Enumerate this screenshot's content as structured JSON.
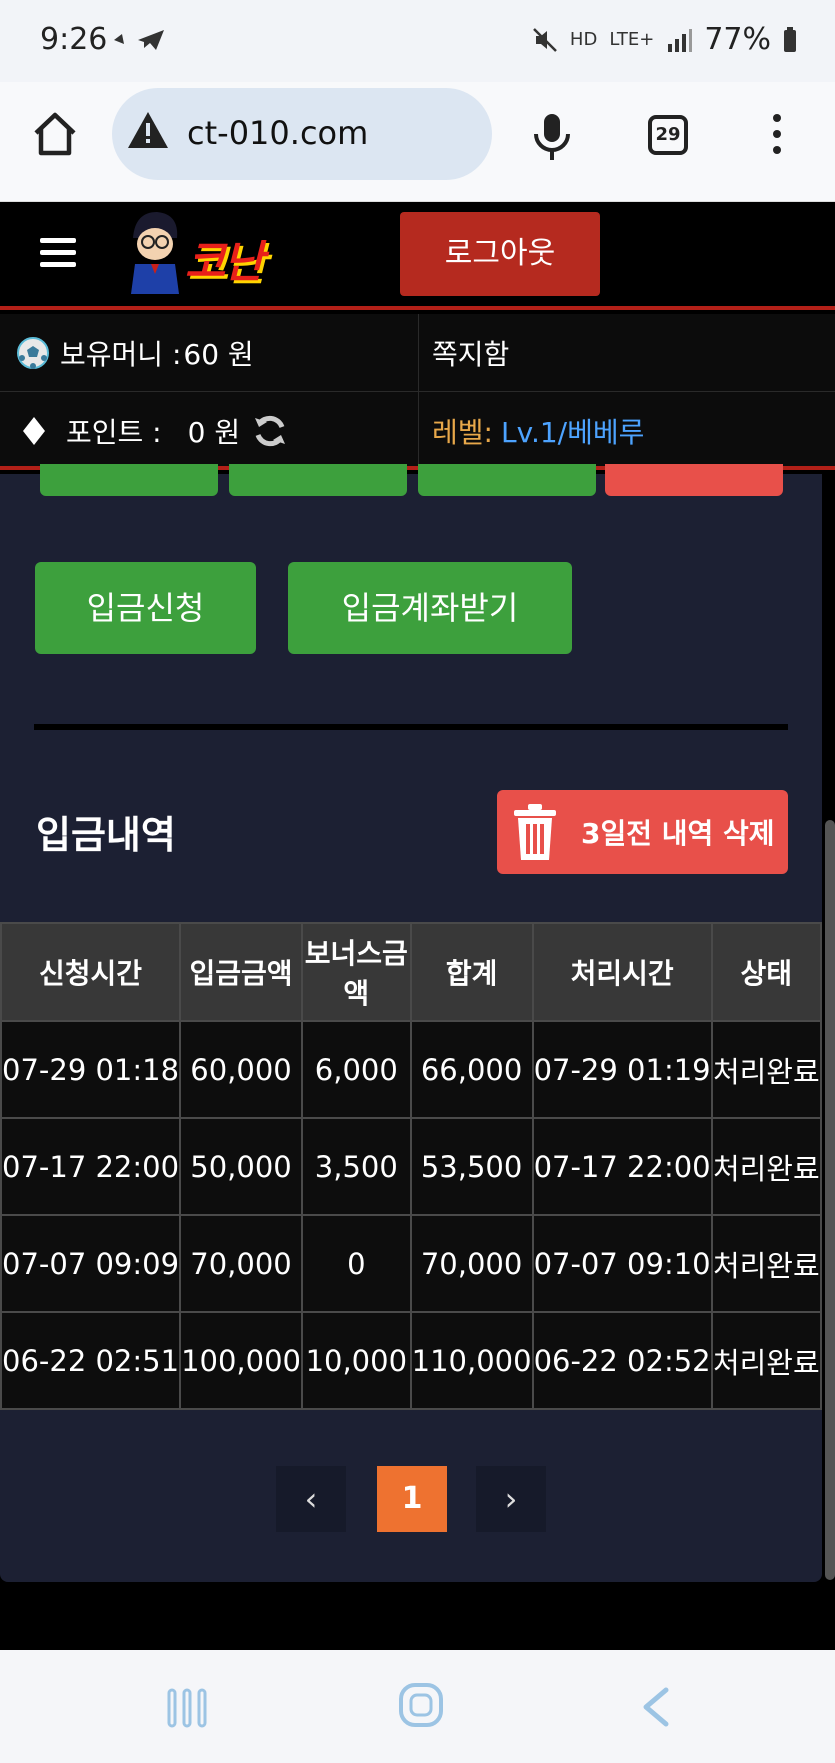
{
  "status_bar": {
    "time": "9:26",
    "network": "LTE+",
    "battery": "77%"
  },
  "browser": {
    "url": "ct-010.com",
    "tab_count": "29"
  },
  "header": {
    "logo_text": "코난",
    "logout_label": "로그아웃"
  },
  "info": {
    "money_label": "보유머니 :",
    "money_value": "60 원",
    "message_label": "쪽지함",
    "point_label": "포인트 :",
    "point_value": "0 원",
    "level_label": "레벨:",
    "level_value": "Lv.1/베베루"
  },
  "actions": {
    "deposit_request": "입금신청",
    "deposit_account": "입금계좌받기"
  },
  "history": {
    "title": "입금내역",
    "delete_label": "3일전 내역 삭제",
    "columns": [
      "신청시간",
      "입금금액",
      "보너스금액",
      "합계",
      "처리시간",
      "상태"
    ],
    "rows": [
      [
        "07-29 01:18",
        "60,000",
        "6,000",
        "66,000",
        "07-29 01:19",
        "처리완료"
      ],
      [
        "07-17 22:00",
        "50,000",
        "3,500",
        "53,500",
        "07-17 22:00",
        "처리완료"
      ],
      [
        "07-07 09:09",
        "70,000",
        "0",
        "70,000",
        "07-07 09:10",
        "처리완료"
      ],
      [
        "06-22 02:51",
        "100,000",
        "10,000",
        "110,000",
        "06-22 02:52",
        "처리완료"
      ]
    ]
  },
  "pagination": {
    "prev": "‹",
    "current": "1",
    "next": "›"
  },
  "colors": {
    "accent_red": "#b52a1f",
    "button_green": "#3da03d",
    "delete_red": "#e8504a",
    "page_orange": "#ee7230",
    "content_bg": "#1c2033",
    "level_blue": "#4da3ff",
    "level_label_orange": "#e8a84a"
  }
}
